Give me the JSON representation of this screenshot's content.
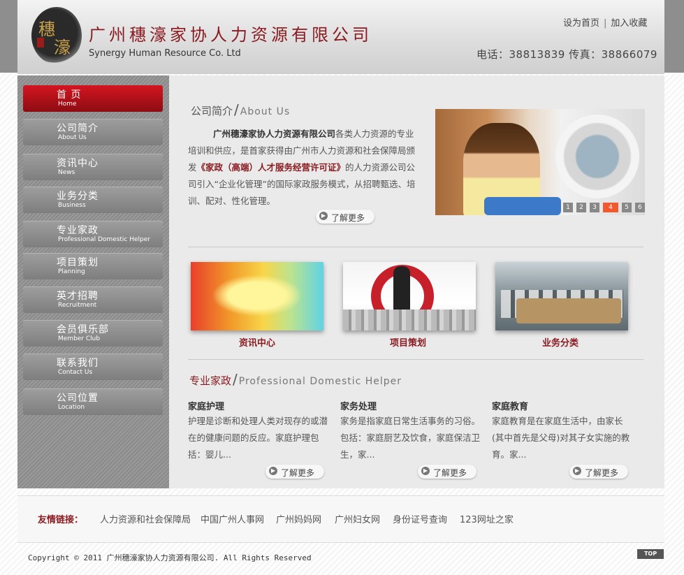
{
  "header": {
    "company_cn": "广州穗濠家协人力资源有限公司",
    "company_en": "Synergy Human Resource Co. Ltd",
    "logo_chars": [
      "穗",
      "濠"
    ],
    "set_home": "设为首页",
    "link_sep": "|",
    "bookmark": "加入收藏",
    "contact": "电话：38813839  传真：38866079"
  },
  "sidebar": {
    "items": [
      {
        "cn": "首 页",
        "en": "Home"
      },
      {
        "cn": "公司简介",
        "en": "About Us"
      },
      {
        "cn": "资讯中心",
        "en": "News"
      },
      {
        "cn": "业务分类",
        "en": "Business"
      },
      {
        "cn": "专业家政",
        "en": "Professional Domestic Helper"
      },
      {
        "cn": "项目策划",
        "en": "Planning"
      },
      {
        "cn": "英才招聘",
        "en": "Recruitment"
      },
      {
        "cn": "会员俱乐部",
        "en": "Member Club"
      },
      {
        "cn": "联系我们",
        "en": "Contact Us"
      },
      {
        "cn": "公司位置",
        "en": "Location"
      }
    ]
  },
  "about": {
    "title_cn": "公司简介",
    "slash": "/",
    "title_en": "About Us",
    "company": "广州穗濠家协人力资源有限公司",
    "text1": "各类人力资源的专业培训和供应，是首家获得由广州市人力资源和社会保障局颁发",
    "license": "《家政（高端）人才服务经营许可证》",
    "text2": "的人力资源公司公司引入“企业化管理”的国际家政服务模式，从招聘甄选、培训、配对、性化管理。",
    "more": "了解更多"
  },
  "slideshow": {
    "pages": [
      "1",
      "2",
      "3",
      "4",
      "5",
      "6"
    ],
    "active_page": "4"
  },
  "cards": [
    {
      "label": "资讯中心"
    },
    {
      "label": "项目策划"
    },
    {
      "label": "业务分类"
    }
  ],
  "domestic": {
    "title_cn": "专业家政",
    "slash": "/",
    "title_en": "Professional Domestic Helper",
    "columns": [
      {
        "title": "家庭护理",
        "text": "护理是诊断和处理人类对现存的或潜在的健康问题的反应。家庭护理包括：婴儿...",
        "more": "了解更多"
      },
      {
        "title": "家务处理",
        "text": "家务是指家庭日常生活事务的习俗。包括：家庭厨艺及饮食，家庭保洁卫生，家...",
        "more": "了解更多"
      },
      {
        "title": "家庭教育",
        "text": "家庭教育是在家庭生活中，由家长(其中首先是父母)对其子女实施的教育。家...",
        "more": "了解更多"
      }
    ]
  },
  "footer": {
    "links_label": "友情链接：",
    "links": [
      "人力资源和社会保障局",
      "中国广州人事网",
      "广州妈妈网",
      "广州妇女网",
      "身份证号查询",
      "123网址之家"
    ],
    "copyright": "Copyright © 2011 广州穗濠家协人力资源有限公司. All Rights Reserved",
    "top": "TOP"
  },
  "colors": {
    "accent": "#8a1a1f",
    "active_nav": "#c8121c",
    "sidebar_gray": "#8f8f8f",
    "pager_active": "#f05a30"
  }
}
